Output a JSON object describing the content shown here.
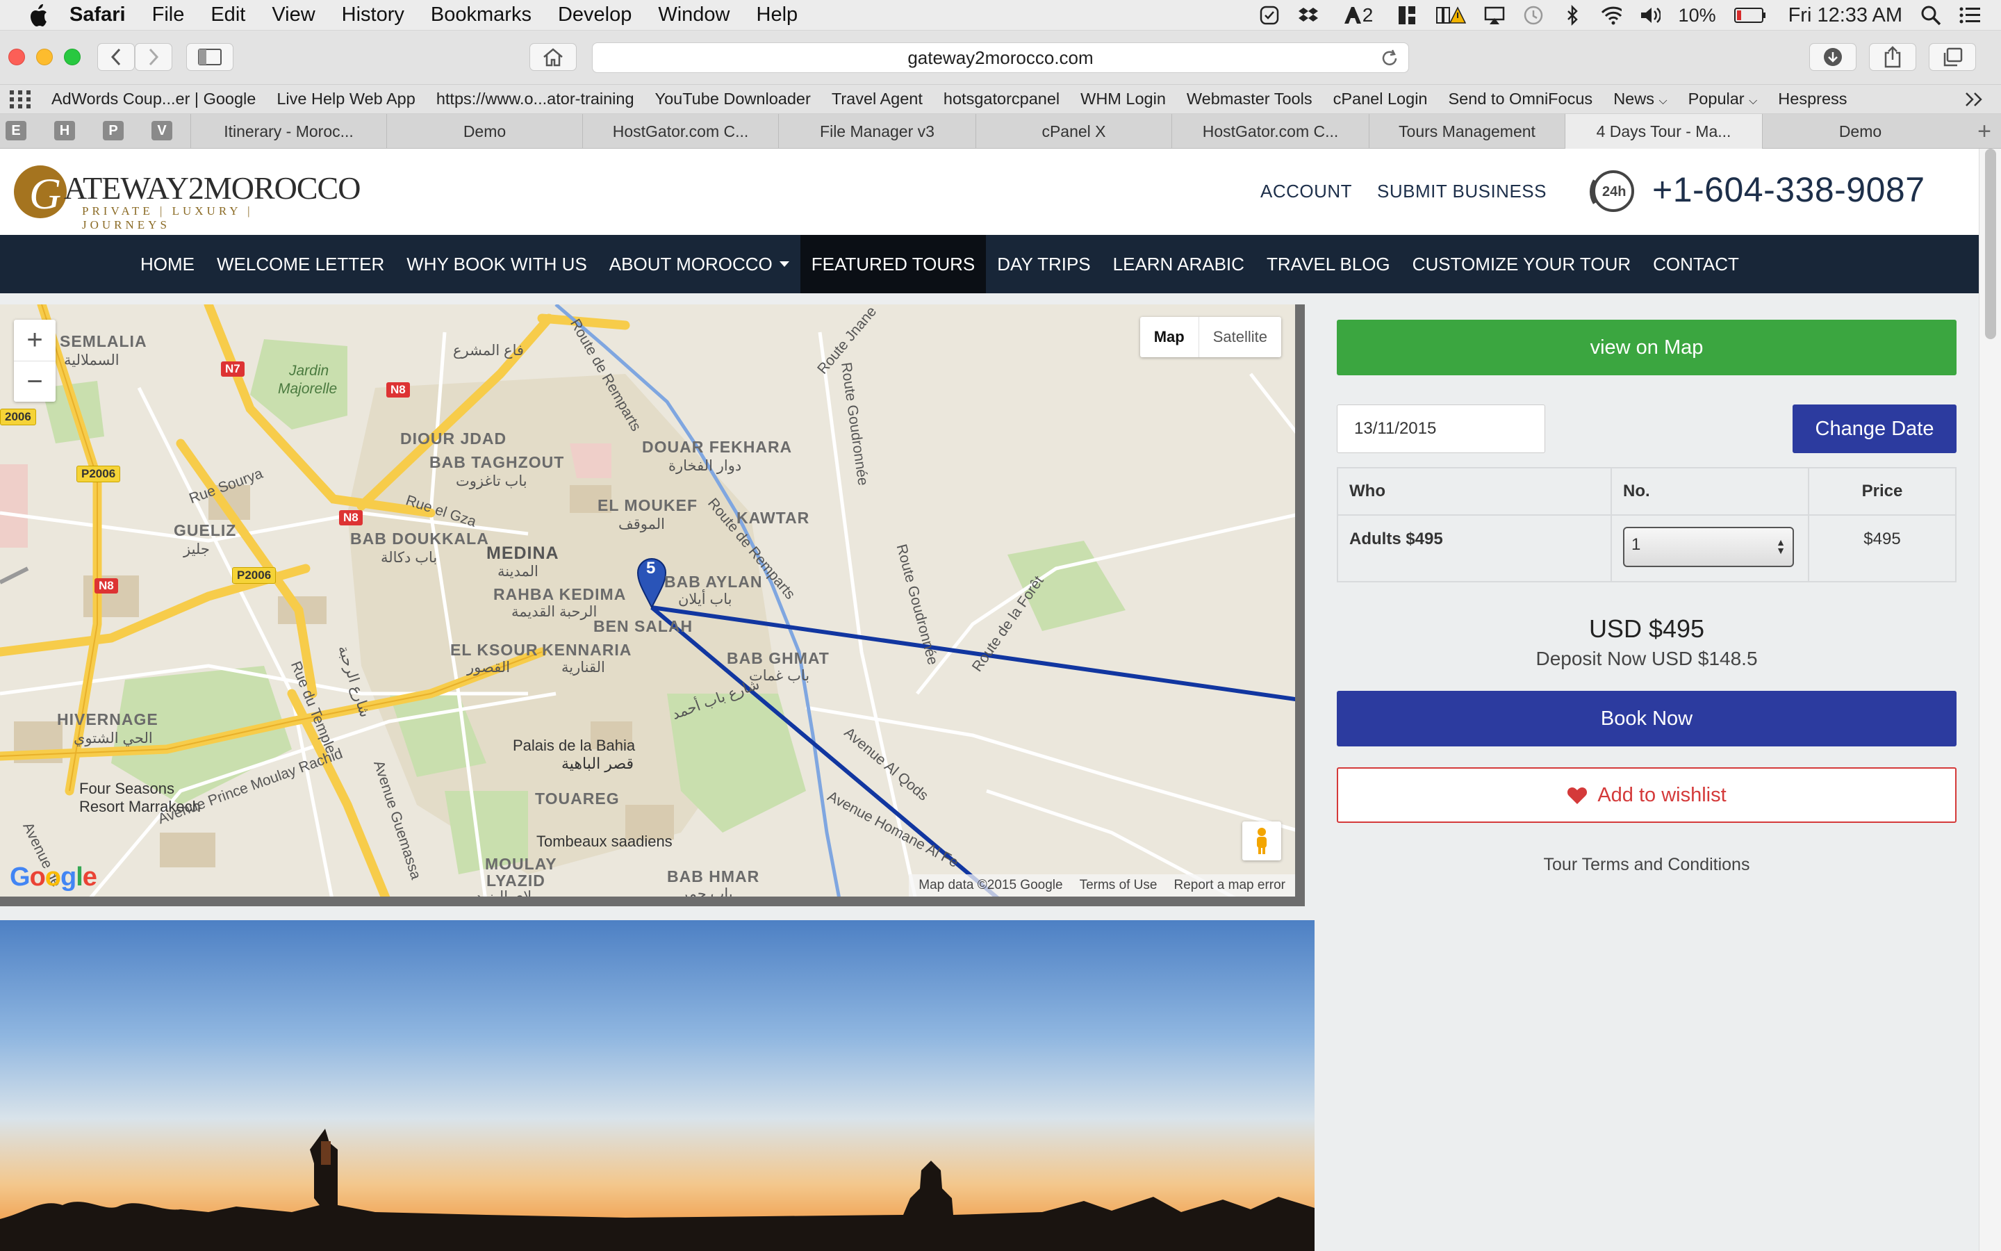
{
  "menubar": {
    "app": "Safari",
    "items": [
      "File",
      "Edit",
      "View",
      "History",
      "Bookmarks",
      "Develop",
      "Window",
      "Help"
    ],
    "tray_text": "2",
    "battery": "10%",
    "clock": "Fri 12:33 AM"
  },
  "browser": {
    "url": "gateway2morocco.com",
    "bookmarks": [
      "AdWords Coup...er | Google",
      "Live Help Web App",
      "https://www.o...ator-training",
      "YouTube Downloader",
      "Travel Agent",
      "hotsgatorcpanel",
      "WHM Login",
      "Webmaster Tools",
      "cPanel Login",
      "Send to OmniFocus",
      "News",
      "Popular",
      "Hespress"
    ],
    "pinned_tabs": [
      "E",
      "H",
      "P",
      "V"
    ],
    "tabs": [
      "Itinerary - Moroc...",
      "Demo",
      "HostGator.com C...",
      "File Manager v3",
      "cPanel X",
      "HostGator.com C...",
      "Tours Management",
      "4 Days Tour - Ma...",
      "Demo"
    ],
    "active_tab_index": 7
  },
  "site": {
    "logo_initial": "G",
    "logo_text": "ATEWAY2MOROCCO",
    "logo_tagline": "PRIVATE | LUXURY | JOURNEYS",
    "account_link": "ACCOUNT",
    "submit_link": "SUBMIT BUSINESS",
    "phone_badge": "24h",
    "phone": "+1-604-338-9087",
    "nav": [
      "HOME",
      "WELCOME LETTER",
      "WHY BOOK WITH US",
      "ABOUT MOROCCO",
      "FEATURED TOURS",
      "DAY TRIPS",
      "LEARN ARABIC",
      "TRAVEL BLOG",
      "CUSTOMIZE YOUR TOUR",
      "CONTACT"
    ],
    "nav_active_index": 4,
    "nav_dropdown_index": 3
  },
  "map": {
    "type_map": "Map",
    "type_satellite": "Satellite",
    "zoom_in": "+",
    "zoom_out": "−",
    "marker_number": "5",
    "footer_data": "Map data ©2015 Google",
    "footer_terms": "Terms of Use",
    "footer_report": "Report a map error",
    "google": "Google",
    "labels": [
      "SEMLALIA",
      "السملالية",
      "Jardin",
      "Majorelle",
      "فاع المشرع",
      "DIOUR JDAD",
      "BAB TAGHZOUT",
      "باب تاغزوت",
      "DOUAR FEKHARA",
      "دوار الفخارة",
      "Rue Sourya",
      "Rue el Gza",
      "GUELIZ",
      "جليز",
      "BAB DOUKKALA",
      "باب دكالة",
      "EL MOUKEF",
      "الموقف",
      "KAWTAR",
      "MEDINA",
      "المدينة",
      "RAHBA KEDIMA",
      "الرحبة القديمة",
      "BAB AYLAN",
      "باب أيلان",
      "BEN SALAH",
      "EL KSOUR",
      "القصور",
      "KENNARIA",
      "القنارية",
      "BAB GHMAT",
      "باب غمات",
      "HIVERNAGE",
      "الحي الشتوي",
      "Palais de la Bahia",
      "قصر الباهية",
      "Four Seasons",
      "Resort Marrakech",
      "TOUAREG",
      "Tombeaux saadiens",
      "MOULAY",
      "LYAZID",
      "مولاي اليزيد",
      "BAB HMAR",
      "باب حمر",
      "Route de Remparts",
      "Route Jnane",
      "Route Goudronnée",
      "Route de la Forêt",
      "Avenue Al Qods",
      "Avenue Homane Al Fe",
      "Avenue Prince Moulay Rachid",
      "Avenue Guemassa",
      "Rue du Temple",
      "Avenue de",
      "شارع الرحبة",
      "شارع باب أحمد"
    ],
    "shields": [
      "N7",
      "N8",
      "N8",
      "N8",
      "P2006",
      "P2006",
      "2006"
    ]
  },
  "booking": {
    "view_on_map": "view on Map",
    "date": "13/11/2015",
    "change_date": "Change Date",
    "col_who": "Who",
    "col_no": "No.",
    "col_price": "Price",
    "row_who": "Adults $495",
    "row_qty": "1",
    "row_price": "$495",
    "total": "USD $495",
    "deposit": "Deposit Now USD $148.5",
    "book_now": "Book Now",
    "wishlist": "Add to wishlist",
    "terms": "Tour Terms and Conditions"
  },
  "colors": {
    "nav_bg": "#182638",
    "green": "#3ba640",
    "blue": "#2c3b9f",
    "wish_red": "#d43a3a",
    "route": "#1136a0"
  }
}
